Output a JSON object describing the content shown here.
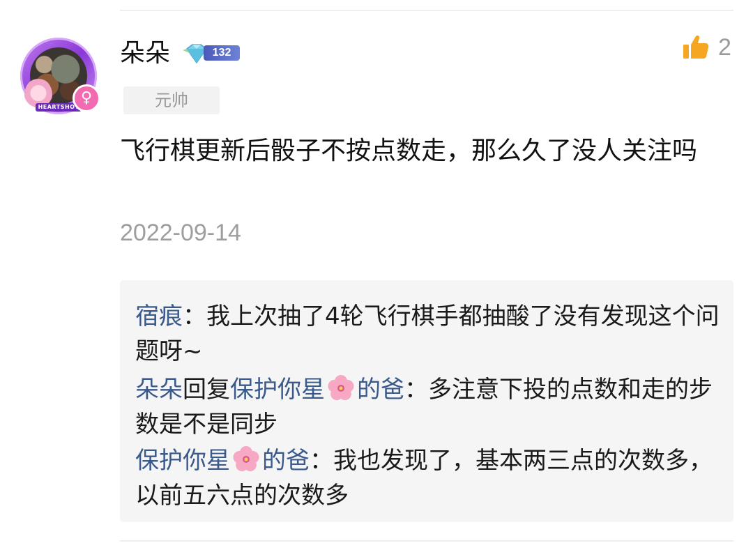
{
  "comment": {
    "username": "朵朵",
    "level": "132",
    "title_tag": "元帅",
    "like_count": "2",
    "text": "飞行棋更新后骰子不按点数走，那么久了没人关注吗",
    "date": "2022-09-14",
    "avatar_frame_text": "HEARTSHOT",
    "gender_symbol": "♀"
  },
  "replies": [
    {
      "user": "宿痕",
      "separator": "：",
      "text": "我上次抽了4轮飞行棋手都抽酸了没有发现这个问题呀~"
    },
    {
      "user": "朵朵",
      "reply_word": "回复",
      "target_pre": "保护你星",
      "target_post": "的爸",
      "separator": "：",
      "text": "多注意下投的点数和走的步数是不是同步"
    },
    {
      "user_pre": "保护你星",
      "user_post": "的爸",
      "separator": "：",
      "text": "我也发现了，基本两三点的次数多，以前五六点的次数多"
    }
  ],
  "colors": {
    "link": "#3b5a8c",
    "like": "#f5a623",
    "muted": "#9e9e9e",
    "reply_bg": "#f5f5f5"
  },
  "icons": {
    "like": "thumbs-up-icon",
    "level": "diamond-level-icon",
    "flower": "cherry-blossom-emoji",
    "gender": "female-symbol-icon"
  }
}
